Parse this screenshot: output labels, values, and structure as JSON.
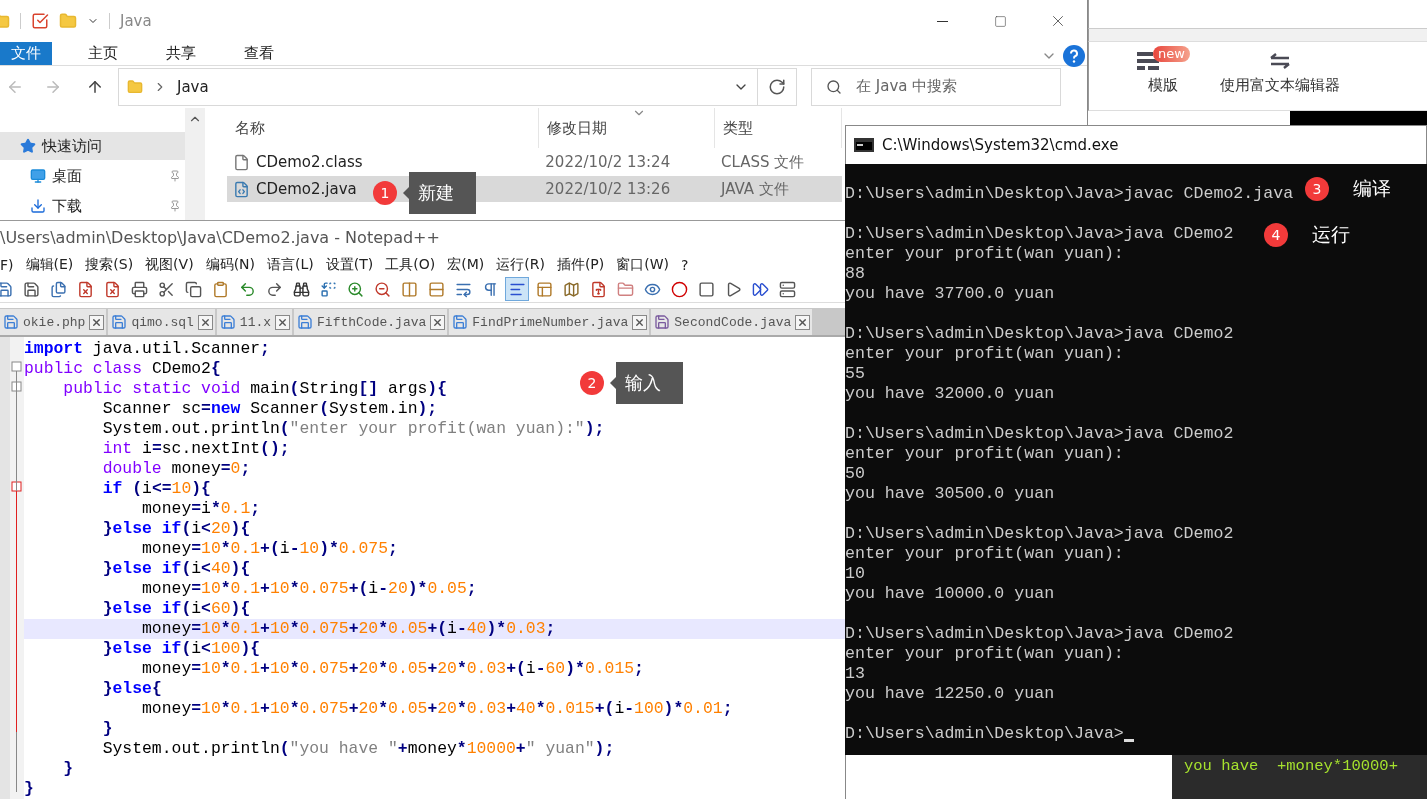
{
  "background_editor": {
    "toolbar": [
      {
        "label": "模版",
        "badge": "new"
      },
      {
        "label": "使用富文本编辑器"
      }
    ],
    "code_fragment": "you have  +money*10000+"
  },
  "explorer": {
    "title": "Java",
    "ribbon_tabs": [
      {
        "label": "文件",
        "selected": true
      },
      {
        "label": "主页",
        "selected": false
      },
      {
        "label": "共享",
        "selected": false
      },
      {
        "label": "查看",
        "selected": false
      }
    ],
    "address": "Java",
    "search": {
      "placeholder": "在 Java 中搜索"
    },
    "nav_items": [
      {
        "label": "快速访问",
        "selected": true
      },
      {
        "label": "桌面",
        "selected": false
      },
      {
        "label": "下载",
        "selected": false
      }
    ],
    "columns": [
      "名称",
      "修改日期",
      "类型"
    ],
    "files": [
      {
        "kind": "class",
        "name": "CDemo2.class",
        "modified": "2022/10/2 13:24",
        "type": "CLASS 文件",
        "selected": false
      },
      {
        "kind": "java",
        "name": "CDemo2.java",
        "modified": "2022/10/2 13:26",
        "type": "JAVA 文件",
        "selected": true
      }
    ]
  },
  "notepad": {
    "title": "\\Users\\admin\\Desktop\\Java\\CDemo2.java - Notepad++",
    "menu": [
      "F)",
      "编辑(E)",
      "搜索(S)",
      "视图(V)",
      "编码(N)",
      "语言(L)",
      "设置(T)",
      "工具(O)",
      "宏(M)",
      "运行(R)",
      "插件(P)",
      "窗口(W)",
      "?"
    ],
    "toolbar": [
      {
        "pressed": false
      },
      {
        "pressed": false
      },
      {
        "pressed": false
      },
      {
        "pressed": false
      },
      {
        "pressed": false
      },
      {
        "pressed": false
      },
      {
        "pressed": false
      },
      {
        "pressed": false
      },
      {
        "pressed": false
      },
      {
        "pressed": false
      },
      {
        "pressed": false
      },
      {
        "pressed": false
      },
      {
        "pressed": false
      },
      {
        "pressed": false
      },
      {
        "pressed": false
      },
      {
        "pressed": false
      },
      {
        "pressed": false
      },
      {
        "pressed": false
      },
      {
        "pressed": false
      },
      {
        "pressed": true
      },
      {
        "pressed": false
      },
      {
        "pressed": false
      },
      {
        "pressed": false
      },
      {
        "pressed": false
      },
      {
        "pressed": false
      },
      {
        "pressed": false
      },
      {
        "pressed": false
      },
      {
        "pressed": false
      },
      {
        "pressed": false
      },
      {
        "pressed": false
      }
    ],
    "tabs": [
      {
        "label": "okie.php",
        "color": "#3d7fd6"
      },
      {
        "label": "qimo.sql",
        "color": "#3d7fd6"
      },
      {
        "label": "11.x",
        "color": "#3d7fd6"
      },
      {
        "label": "FifthCode.java",
        "color": "#3d7fd6"
      },
      {
        "label": "FindPrimeNumber.java",
        "color": "#3d7fd6"
      },
      {
        "label": "SecondCode.java",
        "color": "#7a5a9e"
      }
    ],
    "code": [
      {
        "current": false,
        "tokens": [
          {
            "kind": "kw",
            "text": "import"
          },
          {
            "kind": "plain",
            "text": " java.util.Scanner"
          },
          {
            "kind": "op",
            "text": ";"
          }
        ]
      },
      {
        "current": false,
        "tokens": [
          {
            "kind": "type",
            "text": "public class"
          },
          {
            "kind": "plain",
            "text": " CDemo2"
          },
          {
            "kind": "op",
            "text": "{"
          }
        ]
      },
      {
        "current": false,
        "tokens": [
          {
            "kind": "type",
            "text": "    public static void"
          },
          {
            "kind": "plain",
            "text": " main"
          },
          {
            "kind": "op",
            "text": "("
          },
          {
            "kind": "plain",
            "text": "String"
          },
          {
            "kind": "op",
            "text": "[]"
          },
          {
            "kind": "plain",
            "text": " args"
          },
          {
            "kind": "op",
            "text": "){"
          }
        ]
      },
      {
        "current": false,
        "tokens": [
          {
            "kind": "plain",
            "text": "        Scanner sc"
          },
          {
            "kind": "op",
            "text": "="
          },
          {
            "kind": "kw",
            "text": "new"
          },
          {
            "kind": "plain",
            "text": " Scanner"
          },
          {
            "kind": "op",
            "text": "("
          },
          {
            "kind": "plain",
            "text": "System.in"
          },
          {
            "kind": "op",
            "text": ");"
          }
        ]
      },
      {
        "current": false,
        "tokens": [
          {
            "kind": "plain",
            "text": "        System.out.println"
          },
          {
            "kind": "op",
            "text": "("
          },
          {
            "kind": "str",
            "text": "\"enter your profit(wan yuan):\""
          },
          {
            "kind": "op",
            "text": ");"
          }
        ]
      },
      {
        "current": false,
        "tokens": [
          {
            "kind": "type",
            "text": "        int"
          },
          {
            "kind": "plain",
            "text": " i"
          },
          {
            "kind": "op",
            "text": "="
          },
          {
            "kind": "plain",
            "text": "sc.nextInt"
          },
          {
            "kind": "op",
            "text": "();"
          }
        ]
      },
      {
        "current": false,
        "tokens": [
          {
            "kind": "type",
            "text": "        double"
          },
          {
            "kind": "plain",
            "text": " money"
          },
          {
            "kind": "op",
            "text": "="
          },
          {
            "kind": "num",
            "text": "0"
          },
          {
            "kind": "op",
            "text": ";"
          }
        ]
      },
      {
        "current": false,
        "tokens": [
          {
            "kind": "kw",
            "text": "        if"
          },
          {
            "kind": "op",
            "text": " ("
          },
          {
            "kind": "plain",
            "text": "i"
          },
          {
            "kind": "op",
            "text": "<="
          },
          {
            "kind": "num",
            "text": "10"
          },
          {
            "kind": "op",
            "text": "){"
          }
        ]
      },
      {
        "current": false,
        "tokens": [
          {
            "kind": "plain",
            "text": "            money"
          },
          {
            "kind": "op",
            "text": "="
          },
          {
            "kind": "plain",
            "text": "i"
          },
          {
            "kind": "op",
            "text": "*"
          },
          {
            "kind": "num",
            "text": "0.1"
          },
          {
            "kind": "op",
            "text": ";"
          }
        ]
      },
      {
        "current": false,
        "tokens": [
          {
            "kind": "op",
            "text": "        }"
          },
          {
            "kind": "kw",
            "text": "else if"
          },
          {
            "kind": "op",
            "text": "("
          },
          {
            "kind": "plain",
            "text": "i"
          },
          {
            "kind": "op",
            "text": "<"
          },
          {
            "kind": "num",
            "text": "20"
          },
          {
            "kind": "op",
            "text": "){"
          }
        ]
      },
      {
        "current": false,
        "tokens": [
          {
            "kind": "plain",
            "text": "            money"
          },
          {
            "kind": "op",
            "text": "="
          },
          {
            "kind": "num",
            "text": "10"
          },
          {
            "kind": "op",
            "text": "*"
          },
          {
            "kind": "num",
            "text": "0.1"
          },
          {
            "kind": "op",
            "text": "+("
          },
          {
            "kind": "plain",
            "text": "i"
          },
          {
            "kind": "op",
            "text": "-"
          },
          {
            "kind": "num",
            "text": "10"
          },
          {
            "kind": "op",
            "text": ")*"
          },
          {
            "kind": "num",
            "text": "0.075"
          },
          {
            "kind": "op",
            "text": ";"
          }
        ]
      },
      {
        "current": false,
        "tokens": [
          {
            "kind": "op",
            "text": "        }"
          },
          {
            "kind": "kw",
            "text": "else if"
          },
          {
            "kind": "op",
            "text": "("
          },
          {
            "kind": "plain",
            "text": "i"
          },
          {
            "kind": "op",
            "text": "<"
          },
          {
            "kind": "num",
            "text": "40"
          },
          {
            "kind": "op",
            "text": "){"
          }
        ]
      },
      {
        "current": false,
        "tokens": [
          {
            "kind": "plain",
            "text": "            money"
          },
          {
            "kind": "op",
            "text": "="
          },
          {
            "kind": "num",
            "text": "10"
          },
          {
            "kind": "op",
            "text": "*"
          },
          {
            "kind": "num",
            "text": "0.1"
          },
          {
            "kind": "op",
            "text": "+"
          },
          {
            "kind": "num",
            "text": "10"
          },
          {
            "kind": "op",
            "text": "*"
          },
          {
            "kind": "num",
            "text": "0.075"
          },
          {
            "kind": "op",
            "text": "+("
          },
          {
            "kind": "plain",
            "text": "i"
          },
          {
            "kind": "op",
            "text": "-"
          },
          {
            "kind": "num",
            "text": "20"
          },
          {
            "kind": "op",
            "text": ")*"
          },
          {
            "kind": "num",
            "text": "0.05"
          },
          {
            "kind": "op",
            "text": ";"
          }
        ]
      },
      {
        "current": false,
        "tokens": [
          {
            "kind": "op",
            "text": "        }"
          },
          {
            "kind": "kw",
            "text": "else if"
          },
          {
            "kind": "op",
            "text": "("
          },
          {
            "kind": "plain",
            "text": "i"
          },
          {
            "kind": "op",
            "text": "<"
          },
          {
            "kind": "num",
            "text": "60"
          },
          {
            "kind": "op",
            "text": "){"
          }
        ]
      },
      {
        "current": true,
        "tokens": [
          {
            "kind": "plain",
            "text": "            money"
          },
          {
            "kind": "op",
            "text": "="
          },
          {
            "kind": "num",
            "text": "10"
          },
          {
            "kind": "op",
            "text": "*"
          },
          {
            "kind": "num",
            "text": "0.1"
          },
          {
            "kind": "op",
            "text": "+"
          },
          {
            "kind": "num",
            "text": "10"
          },
          {
            "kind": "op",
            "text": "*"
          },
          {
            "kind": "num",
            "text": "0.075"
          },
          {
            "kind": "op",
            "text": "+"
          },
          {
            "kind": "num",
            "text": "20"
          },
          {
            "kind": "op",
            "text": "*"
          },
          {
            "kind": "num",
            "text": "0.05"
          },
          {
            "kind": "op",
            "text": "+("
          },
          {
            "kind": "plain",
            "text": "i"
          },
          {
            "kind": "op",
            "text": "-"
          },
          {
            "kind": "num",
            "text": "40"
          },
          {
            "kind": "op",
            "text": ")*"
          },
          {
            "kind": "num",
            "text": "0.03"
          },
          {
            "kind": "op",
            "text": ";"
          }
        ]
      },
      {
        "current": false,
        "tokens": [
          {
            "kind": "op",
            "text": "        }"
          },
          {
            "kind": "kw",
            "text": "else if"
          },
          {
            "kind": "op",
            "text": "("
          },
          {
            "kind": "plain",
            "text": "i"
          },
          {
            "kind": "op",
            "text": "<"
          },
          {
            "kind": "num",
            "text": "100"
          },
          {
            "kind": "op",
            "text": "){"
          }
        ]
      },
      {
        "current": false,
        "tokens": [
          {
            "kind": "plain",
            "text": "            money"
          },
          {
            "kind": "op",
            "text": "="
          },
          {
            "kind": "num",
            "text": "10"
          },
          {
            "kind": "op",
            "text": "*"
          },
          {
            "kind": "num",
            "text": "0.1"
          },
          {
            "kind": "op",
            "text": "+"
          },
          {
            "kind": "num",
            "text": "10"
          },
          {
            "kind": "op",
            "text": "*"
          },
          {
            "kind": "num",
            "text": "0.075"
          },
          {
            "kind": "op",
            "text": "+"
          },
          {
            "kind": "num",
            "text": "20"
          },
          {
            "kind": "op",
            "text": "*"
          },
          {
            "kind": "num",
            "text": "0.05"
          },
          {
            "kind": "op",
            "text": "+"
          },
          {
            "kind": "num",
            "text": "20"
          },
          {
            "kind": "op",
            "text": "*"
          },
          {
            "kind": "num",
            "text": "0.03"
          },
          {
            "kind": "op",
            "text": "+("
          },
          {
            "kind": "plain",
            "text": "i"
          },
          {
            "kind": "op",
            "text": "-"
          },
          {
            "kind": "num",
            "text": "60"
          },
          {
            "kind": "op",
            "text": ")*"
          },
          {
            "kind": "num",
            "text": "0.015"
          },
          {
            "kind": "op",
            "text": ";"
          }
        ]
      },
      {
        "current": false,
        "tokens": [
          {
            "kind": "op",
            "text": "        }"
          },
          {
            "kind": "kw",
            "text": "else"
          },
          {
            "kind": "op",
            "text": "{"
          }
        ]
      },
      {
        "current": false,
        "tokens": [
          {
            "kind": "plain",
            "text": "            money"
          },
          {
            "kind": "op",
            "text": "="
          },
          {
            "kind": "num",
            "text": "10"
          },
          {
            "kind": "op",
            "text": "*"
          },
          {
            "kind": "num",
            "text": "0.1"
          },
          {
            "kind": "op",
            "text": "+"
          },
          {
            "kind": "num",
            "text": "10"
          },
          {
            "kind": "op",
            "text": "*"
          },
          {
            "kind": "num",
            "text": "0.075"
          },
          {
            "kind": "op",
            "text": "+"
          },
          {
            "kind": "num",
            "text": "20"
          },
          {
            "kind": "op",
            "text": "*"
          },
          {
            "kind": "num",
            "text": "0.05"
          },
          {
            "kind": "op",
            "text": "+"
          },
          {
            "kind": "num",
            "text": "20"
          },
          {
            "kind": "op",
            "text": "*"
          },
          {
            "kind": "num",
            "text": "0.03"
          },
          {
            "kind": "op",
            "text": "+"
          },
          {
            "kind": "num",
            "text": "40"
          },
          {
            "kind": "op",
            "text": "*"
          },
          {
            "kind": "num",
            "text": "0.015"
          },
          {
            "kind": "op",
            "text": "+("
          },
          {
            "kind": "plain",
            "text": "i"
          },
          {
            "kind": "op",
            "text": "-"
          },
          {
            "kind": "num",
            "text": "100"
          },
          {
            "kind": "op",
            "text": ")*"
          },
          {
            "kind": "num",
            "text": "0.01"
          },
          {
            "kind": "op",
            "text": ";"
          }
        ]
      },
      {
        "current": false,
        "tokens": [
          {
            "kind": "op",
            "text": "        }"
          }
        ]
      },
      {
        "current": false,
        "tokens": [
          {
            "kind": "plain",
            "text": "        System.out.println"
          },
          {
            "kind": "op",
            "text": "("
          },
          {
            "kind": "str",
            "text": "\"you have \""
          },
          {
            "kind": "op",
            "text": "+"
          },
          {
            "kind": "plain",
            "text": "money"
          },
          {
            "kind": "op",
            "text": "*"
          },
          {
            "kind": "num",
            "text": "10000"
          },
          {
            "kind": "op",
            "text": "+"
          },
          {
            "kind": "str",
            "text": "\" yuan\""
          },
          {
            "kind": "op",
            "text": ");"
          }
        ]
      },
      {
        "current": false,
        "tokens": [
          {
            "kind": "op",
            "text": "    }"
          }
        ]
      },
      {
        "current": false,
        "tokens": [
          {
            "kind": "op",
            "text": "}"
          }
        ]
      }
    ]
  },
  "console": {
    "title": "C:\\Windows\\System32\\cmd.exe",
    "cursor_visible": true,
    "blocks": [
      {
        "lines": [
          "D:\\Users\\admin\\Desktop\\Java>javac CDemo2.java"
        ]
      },
      {
        "lines": [
          "D:\\Users\\admin\\Desktop\\Java>java CDemo2",
          "enter your profit(wan yuan):",
          "88",
          "you have 37700.0 yuan"
        ]
      },
      {
        "lines": [
          "D:\\Users\\admin\\Desktop\\Java>java CDemo2",
          "enter your profit(wan yuan):",
          "55",
          "you have 32000.0 yuan"
        ]
      },
      {
        "lines": [
          "D:\\Users\\admin\\Desktop\\Java>java CDemo2",
          "enter your profit(wan yuan):",
          "50",
          "you have 30500.0 yuan"
        ]
      },
      {
        "lines": [
          "D:\\Users\\admin\\Desktop\\Java>java CDemo2",
          "enter your profit(wan yuan):",
          "10",
          "you have 10000.0 yuan"
        ]
      },
      {
        "lines": [
          "D:\\Users\\admin\\Desktop\\Java>java CDemo2",
          "enter your profit(wan yuan):",
          "13",
          "you have 12250.0 yuan"
        ]
      },
      {
        "lines": [
          "D:\\Users\\admin\\Desktop\\Java>"
        ]
      }
    ]
  },
  "annotations": [
    {
      "number": "1",
      "label": "新建",
      "kind": "boxed"
    },
    {
      "number": "2",
      "label": "输入",
      "kind": "boxed"
    },
    {
      "number": "3",
      "label": "编译",
      "kind": "plain"
    },
    {
      "number": "4",
      "label": "运行",
      "kind": "plain"
    }
  ]
}
